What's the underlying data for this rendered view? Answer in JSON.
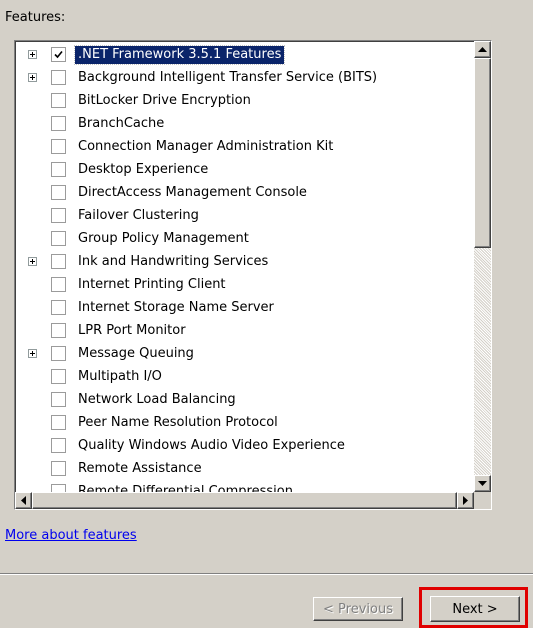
{
  "features_label": "Features:",
  "items": [
    {
      "label": ".NET Framework 3.5.1 Features",
      "expandable": true,
      "checked": true,
      "selected": true
    },
    {
      "label": "Background Intelligent Transfer Service (BITS)",
      "expandable": true,
      "checked": false,
      "selected": false
    },
    {
      "label": "BitLocker Drive Encryption",
      "expandable": false,
      "checked": false,
      "selected": false
    },
    {
      "label": "BranchCache",
      "expandable": false,
      "checked": false,
      "selected": false
    },
    {
      "label": "Connection Manager Administration Kit",
      "expandable": false,
      "checked": false,
      "selected": false
    },
    {
      "label": "Desktop Experience",
      "expandable": false,
      "checked": false,
      "selected": false
    },
    {
      "label": "DirectAccess Management Console",
      "expandable": false,
      "checked": false,
      "selected": false
    },
    {
      "label": "Failover Clustering",
      "expandable": false,
      "checked": false,
      "selected": false
    },
    {
      "label": "Group Policy Management",
      "expandable": false,
      "checked": false,
      "selected": false
    },
    {
      "label": "Ink and Handwriting Services",
      "expandable": true,
      "checked": false,
      "selected": false
    },
    {
      "label": "Internet Printing Client",
      "expandable": false,
      "checked": false,
      "selected": false
    },
    {
      "label": "Internet Storage Name Server",
      "expandable": false,
      "checked": false,
      "selected": false
    },
    {
      "label": "LPR Port Monitor",
      "expandable": false,
      "checked": false,
      "selected": false
    },
    {
      "label": "Message Queuing",
      "expandable": true,
      "checked": false,
      "selected": false
    },
    {
      "label": "Multipath I/O",
      "expandable": false,
      "checked": false,
      "selected": false
    },
    {
      "label": "Network Load Balancing",
      "expandable": false,
      "checked": false,
      "selected": false
    },
    {
      "label": "Peer Name Resolution Protocol",
      "expandable": false,
      "checked": false,
      "selected": false
    },
    {
      "label": "Quality Windows Audio Video Experience",
      "expandable": false,
      "checked": false,
      "selected": false
    },
    {
      "label": "Remote Assistance",
      "expandable": false,
      "checked": false,
      "selected": false
    },
    {
      "label": "Remote Differential Compression",
      "expandable": false,
      "checked": false,
      "selected": false
    }
  ],
  "more_link": "More about features",
  "buttons": {
    "previous": "< Previous",
    "next": "Next >"
  },
  "colors": {
    "selection": "#0a246a",
    "highlight_box": "#e00000",
    "link": "#0000ee"
  }
}
